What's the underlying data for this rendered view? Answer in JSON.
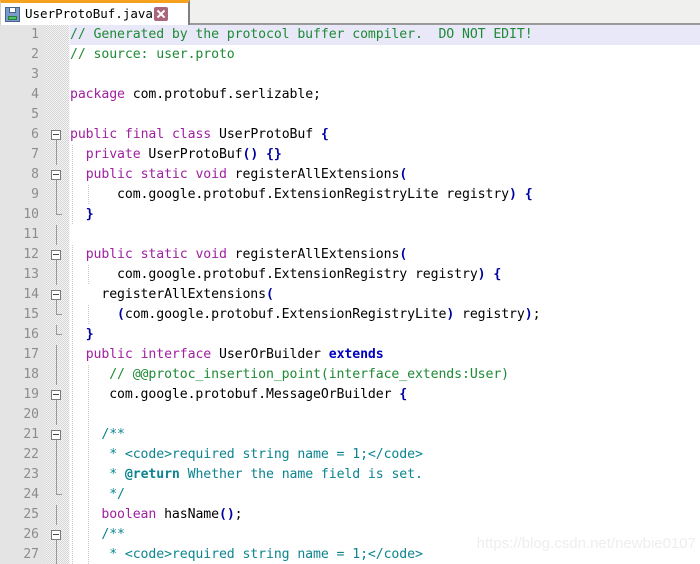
{
  "tab": {
    "filename": "UserProtoBuf.java",
    "save_icon": "floppy-disk-icon",
    "close_icon": "close-x-icon",
    "accent_color": "#f5a11d"
  },
  "editor": {
    "gutter_bg": "#e4e4e4",
    "current_line": 1,
    "current_line_highlight": "#e8e8f8",
    "colors": {
      "keyword": "#a020a0",
      "keyword_bold": "#0000c0",
      "comment": "#1f8a35",
      "javadoc": "#0d8490",
      "bracket": "#0000a0",
      "plain": "#000000",
      "line_number": "#8c8c8c"
    },
    "lines": [
      {
        "n": 1,
        "fold": "none",
        "indent": 0,
        "text": "// Generated by the protocol buffer compiler.  DO NOT EDIT!"
      },
      {
        "n": 2,
        "fold": "none",
        "indent": 0,
        "text": "// source: user.proto"
      },
      {
        "n": 3,
        "fold": "none",
        "indent": 0,
        "text": ""
      },
      {
        "n": 4,
        "fold": "none",
        "indent": 0,
        "text": "package com.protobuf.serlizable;"
      },
      {
        "n": 5,
        "fold": "none",
        "indent": 0,
        "text": ""
      },
      {
        "n": 6,
        "fold": "open",
        "indent": 0,
        "text": "public final class UserProtoBuf {"
      },
      {
        "n": 7,
        "fold": "line",
        "indent": 1,
        "text": "  private UserProtoBuf() {}"
      },
      {
        "n": 8,
        "fold": "open",
        "indent": 1,
        "text": "  public static void registerAllExtensions("
      },
      {
        "n": 9,
        "fold": "line",
        "indent": 2,
        "text": "      com.google.protobuf.ExtensionRegistryLite registry) {"
      },
      {
        "n": 10,
        "fold": "end",
        "indent": 1,
        "text": "  }"
      },
      {
        "n": 11,
        "fold": "line",
        "indent": 0,
        "text": ""
      },
      {
        "n": 12,
        "fold": "open",
        "indent": 1,
        "text": "  public static void registerAllExtensions("
      },
      {
        "n": 13,
        "fold": "line",
        "indent": 2,
        "text": "      com.google.protobuf.ExtensionRegistry registry) {"
      },
      {
        "n": 14,
        "fold": "open",
        "indent": 1,
        "text": "    registerAllExtensions("
      },
      {
        "n": 15,
        "fold": "end",
        "indent": 2,
        "text": "      (com.google.protobuf.ExtensionRegistryLite) registry);"
      },
      {
        "n": 16,
        "fold": "end",
        "indent": 1,
        "text": "  }"
      },
      {
        "n": 17,
        "fold": "line",
        "indent": 1,
        "text": "  public interface UserOrBuilder extends"
      },
      {
        "n": 18,
        "fold": "line",
        "indent": 2,
        "text": "     // @@protoc_insertion_point(interface_extends:User)"
      },
      {
        "n": 19,
        "fold": "open",
        "indent": 2,
        "text": "     com.google.protobuf.MessageOrBuilder {"
      },
      {
        "n": 20,
        "fold": "line",
        "indent": 2,
        "text": ""
      },
      {
        "n": 21,
        "fold": "open",
        "indent": 2,
        "text": "    /**"
      },
      {
        "n": 22,
        "fold": "line",
        "indent": 2,
        "text": "     * <code>required string name = 1;</code>"
      },
      {
        "n": 23,
        "fold": "line",
        "indent": 2,
        "text": "     * @return Whether the name field is set."
      },
      {
        "n": 24,
        "fold": "end",
        "indent": 2,
        "text": "     */"
      },
      {
        "n": 25,
        "fold": "line",
        "indent": 2,
        "text": "    boolean hasName();"
      },
      {
        "n": 26,
        "fold": "open",
        "indent": 2,
        "text": "    /**"
      },
      {
        "n": 27,
        "fold": "line",
        "indent": 2,
        "text": "     * <code>required string name = 1;</code>"
      }
    ]
  },
  "watermark": {
    "text": "https://blog.csdn.net/newbie0107"
  }
}
